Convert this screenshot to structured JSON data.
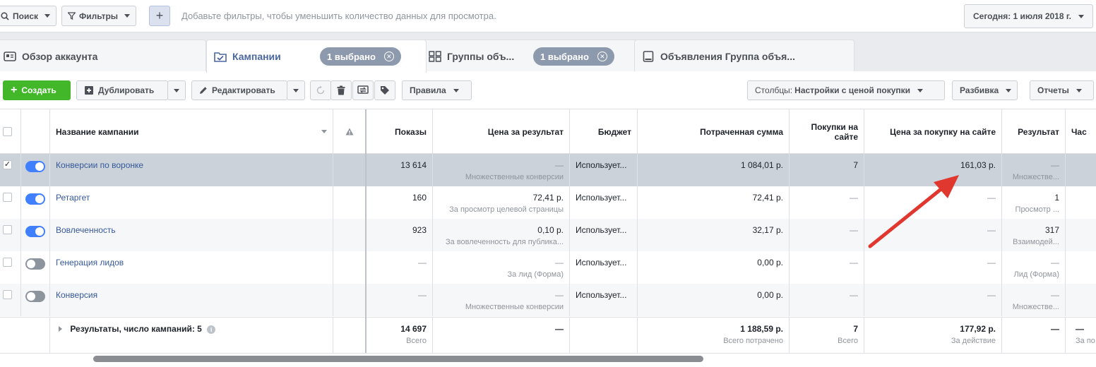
{
  "topbar": {
    "search_label": "Поиск",
    "filters_label": "Фильтры",
    "hint": "Добавьте фильтры, чтобы уменьшить количество данных для просмотра.",
    "date_label": "Сегодня: 1 июля 2018 г."
  },
  "tabs": [
    {
      "label": "Обзор аккаунта",
      "icon": "account-overview-icon"
    },
    {
      "label": "Кампании",
      "icon": "campaigns-folder-icon",
      "badge": "1 выбрано"
    },
    {
      "label": "Группы объ...",
      "icon": "adsets-grid-icon",
      "badge": "1 выбрано"
    },
    {
      "label": "Объявления Группа объя...",
      "icon": "ads-icon"
    }
  ],
  "toolbar": {
    "create_label": "Создать",
    "duplicate_label": "Дублировать",
    "edit_label": "Редактировать",
    "rules_label": "Правила",
    "columns_prefix": "Столбцы:",
    "columns_value": "Настройки с ценой покупки",
    "breakdown_label": "Разбивка",
    "reports_label": "Отчеты"
  },
  "columns": {
    "name": "Название кампании",
    "impressions": "Показы",
    "cost_per_result": "Цена за результат",
    "budget": "Бюджет",
    "amount_spent": "Потраченная сумма",
    "purchases": "Покупки на сайте",
    "cost_per_purchase": "Цена за покупку на сайте",
    "results": "Результат",
    "last": "Час"
  },
  "rows": [
    {
      "selected": true,
      "checked": "✓",
      "on": true,
      "name": "Конверсии по воронке",
      "impressions": "13 614",
      "cpr": "—",
      "cpr_sub": "Множественные конверсии",
      "budget": "Использует...",
      "spent": "1 084,01 р.",
      "purchases": "7",
      "cpp": "161,03 р.",
      "result": "—",
      "result_sub": "Множестве..."
    },
    {
      "selected": false,
      "checked": "",
      "on": true,
      "name": "Ретаргет",
      "impressions": "160",
      "cpr": "72,41 р.",
      "cpr_sub": "За просмотр целевой страницы",
      "budget": "Использует...",
      "spent": "72,41 р.",
      "purchases": "—",
      "cpp": "—",
      "result": "1",
      "result_sub": "Просмотр ..."
    },
    {
      "selected": false,
      "checked": "",
      "on": true,
      "name": "Вовлеченность",
      "impressions": "923",
      "cpr": "0,10 р.",
      "cpr_sub": "За вовлеченность для публика...",
      "budget": "Использует...",
      "spent": "32,17 р.",
      "purchases": "—",
      "cpp": "—",
      "result": "317",
      "result_sub": "Взаимодей..."
    },
    {
      "selected": false,
      "checked": "",
      "on": false,
      "name": "Генерация лидов",
      "impressions": "—",
      "cpr": "—",
      "cpr_sub": "За лид (Форма)",
      "budget": "Использует...",
      "spent": "0,00 р.",
      "purchases": "—",
      "cpp": "—",
      "result": "—",
      "result_sub": "Лид (Форма)"
    },
    {
      "selected": false,
      "checked": "",
      "on": false,
      "name": "Конверсия",
      "impressions": "—",
      "cpr": "—",
      "cpr_sub": "Множественные конверсии",
      "budget": "Использует...",
      "spent": "0,00 р.",
      "purchases": "—",
      "cpp": "—",
      "result": "—",
      "result_sub": "Множестве..."
    }
  ],
  "totals": {
    "label": "Результаты, число кампаний: 5",
    "impressions": "14 697",
    "impressions_sub": "Всего",
    "cpr": "—",
    "spent": "1 188,59 р.",
    "spent_sub": "Всего потрачено",
    "purchases": "7",
    "purchases_sub": "Всего",
    "cpp": "177,92 р.",
    "cpp_sub": "За действие",
    "result": "—",
    "last": "—",
    "last_sub": "За по"
  },
  "colors": {
    "accent": "#4080ff",
    "create": "#42b72a",
    "arrow": "#e0372f",
    "selected_row": "#cbd2d9"
  }
}
